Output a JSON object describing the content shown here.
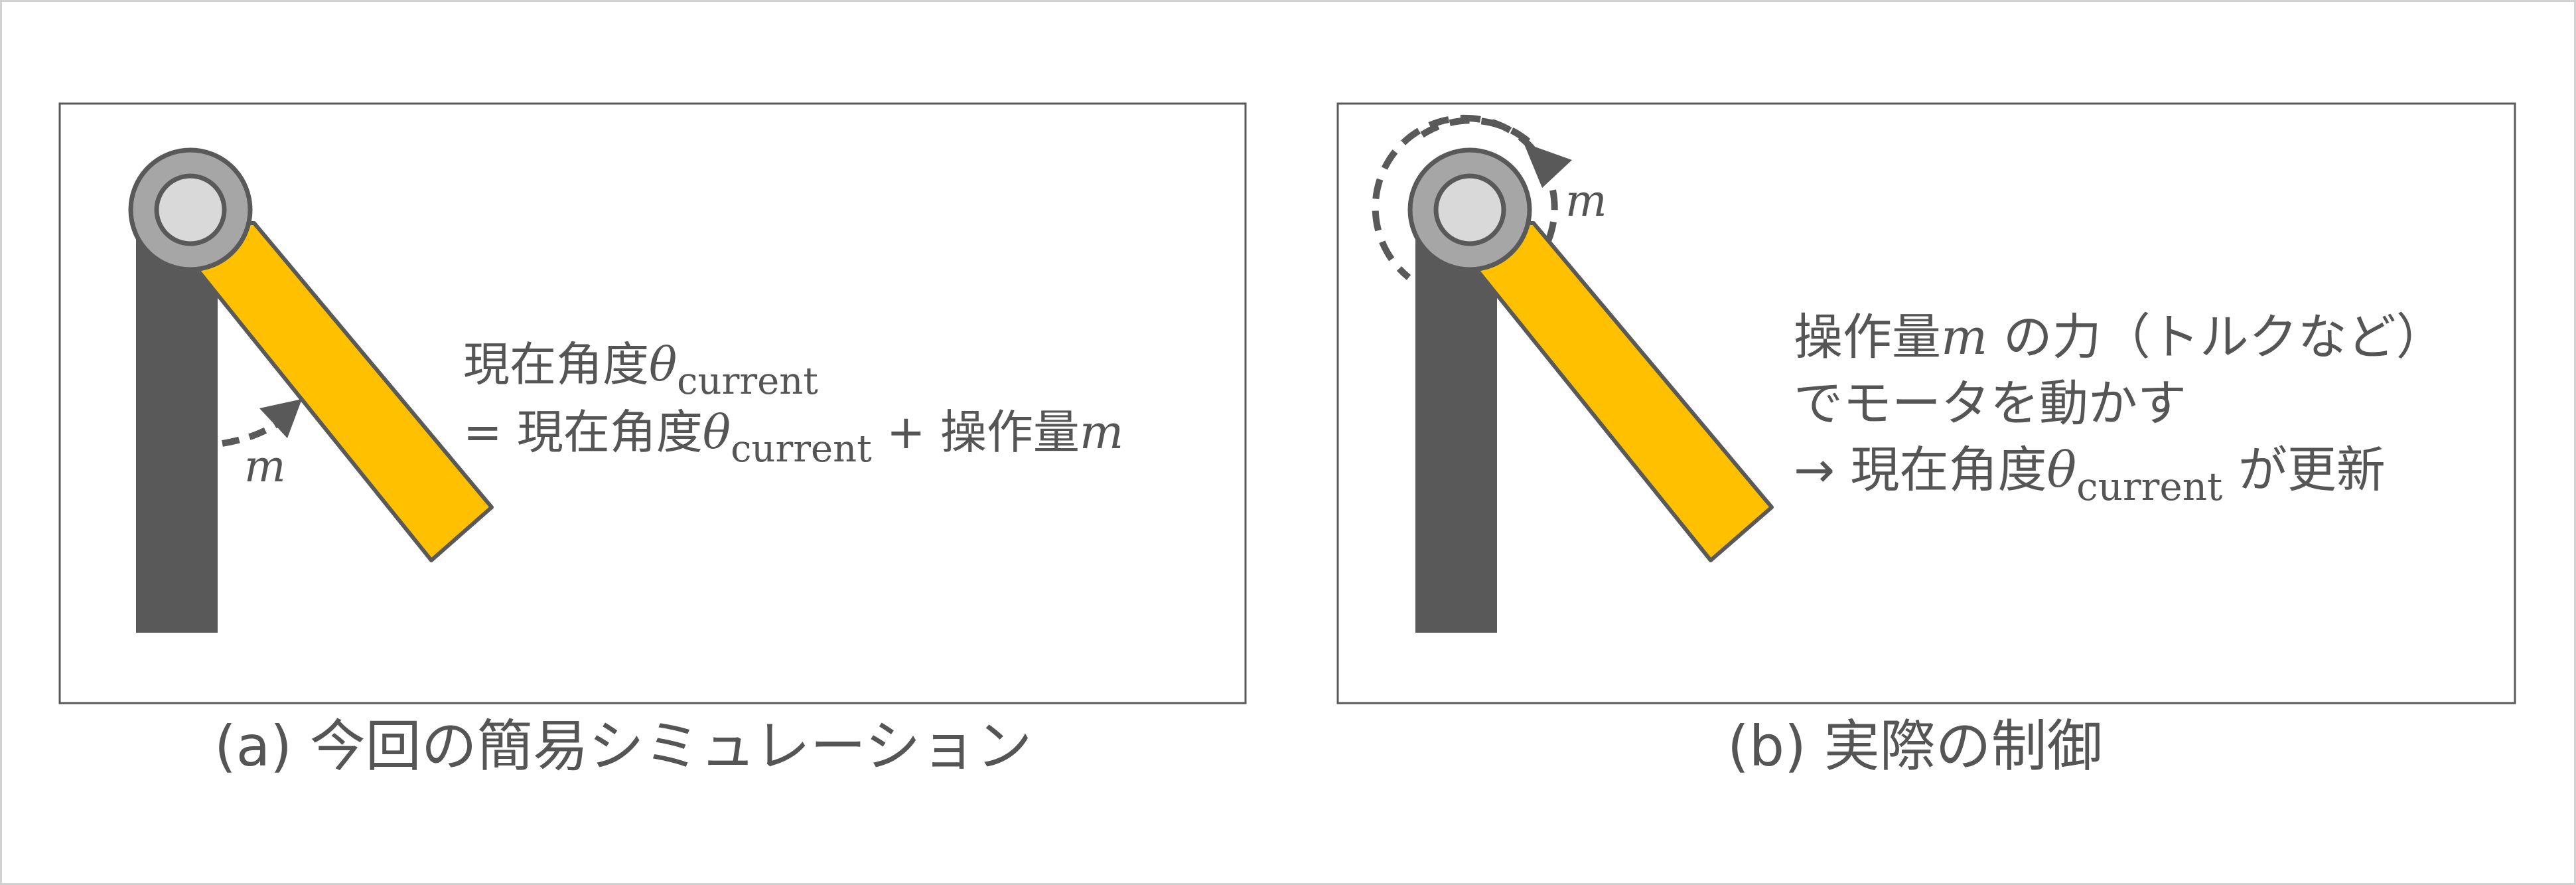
{
  "colors": {
    "pillar": "#595959",
    "arm": "#ffc000",
    "arm_outline": "#595959",
    "joint_outer": "#a6a6a6",
    "joint_inner": "#d9d9d9",
    "text": "#555555",
    "frame": "#595959",
    "page_border": "#d2d2d2"
  },
  "panel_a": {
    "caption": "(a) 今回の簡易シミュレーション",
    "arrow_label": "m",
    "eq_line1_prefix": "現在角度",
    "eq_theta": "θ",
    "eq_sub": "current",
    "eq_line2_prefix": "= 現在角度",
    "eq_line2_plus": " + 操作量",
    "eq_m": "m"
  },
  "panel_b": {
    "caption": "(b) 実際の制御",
    "arrow_label": "m",
    "line1_prefix": "操作量",
    "line1_m": "m",
    "line1_rest": " の力（トルクなど）",
    "line2": "でモータを動かす",
    "line3_prefix": "→ 現在角度",
    "line3_theta": "θ",
    "line3_sub": "current",
    "line3_rest": " が更新"
  }
}
